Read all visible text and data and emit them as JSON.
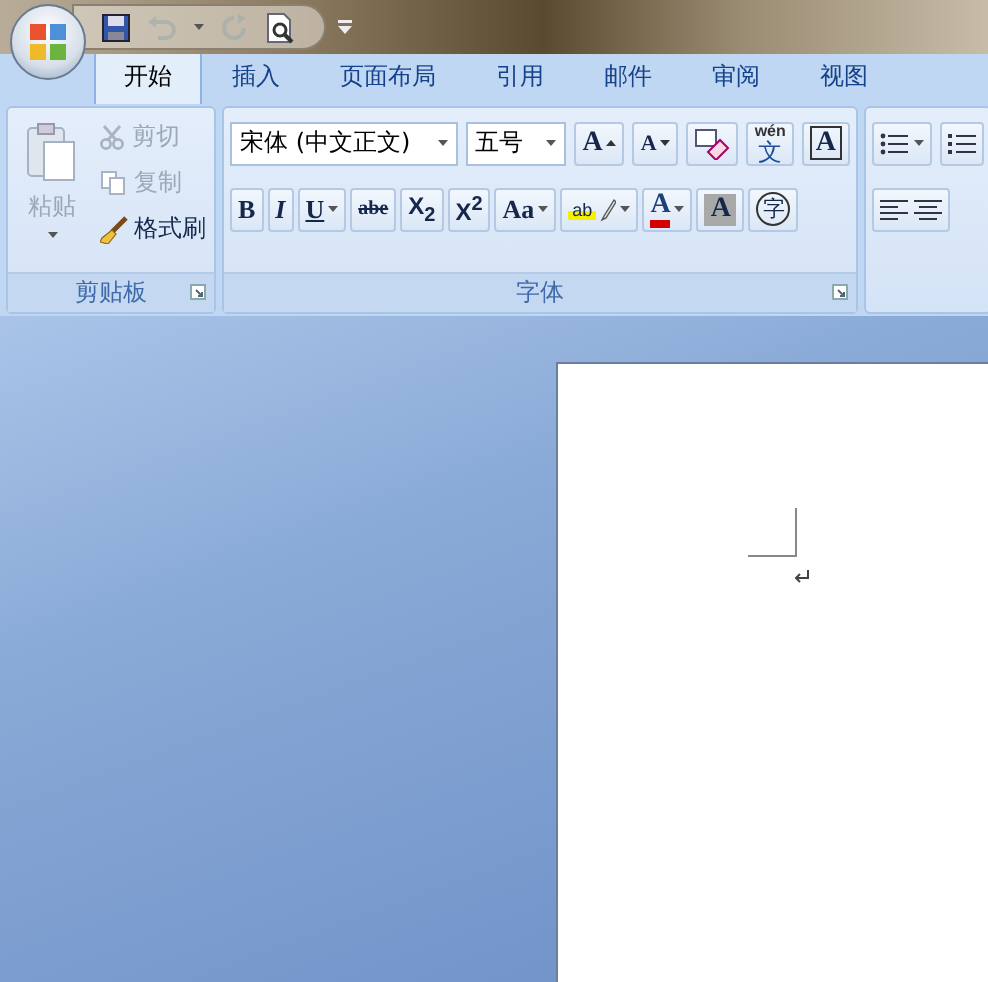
{
  "quick_access": [
    {
      "kind": "save",
      "disabled": false
    },
    {
      "kind": "undo",
      "disabled": true
    },
    {
      "kind": "redo",
      "disabled": true
    },
    {
      "kind": "print-preview",
      "disabled": false
    }
  ],
  "tabs": [
    {
      "label": "开始",
      "selected": true
    },
    {
      "label": "插入",
      "selected": false
    },
    {
      "label": "页面布局",
      "selected": false
    },
    {
      "label": "引用",
      "selected": false
    },
    {
      "label": "邮件",
      "selected": false
    },
    {
      "label": "审阅",
      "selected": false
    },
    {
      "label": "视图",
      "selected": false
    }
  ],
  "clipboard": {
    "title": "剪贴板",
    "paste": {
      "label": "粘贴",
      "disabled": true
    },
    "items": [
      {
        "kind": "cut",
        "label": "剪切",
        "disabled": true
      },
      {
        "kind": "copy",
        "label": "复制",
        "disabled": true
      },
      {
        "kind": "format-painter",
        "label": "格式刷",
        "disabled": false
      }
    ]
  },
  "font": {
    "title": "字体",
    "font_name": "宋体 (中文正文)",
    "font_size": "五号",
    "row1": [
      {
        "kind": "grow",
        "label": "A"
      },
      {
        "kind": "shrink",
        "label": "A"
      },
      {
        "kind": "clear"
      },
      {
        "kind": "pinyin",
        "label": "wén",
        "sub": "文"
      },
      {
        "kind": "border",
        "label": "A"
      }
    ],
    "row2": [
      {
        "kind": "bold",
        "label": "B"
      },
      {
        "kind": "italic",
        "label": "I"
      },
      {
        "kind": "underline",
        "label": "U"
      },
      {
        "kind": "strike",
        "label": "abe"
      },
      {
        "kind": "subscript",
        "label": "X$_{2}$"
      },
      {
        "kind": "superscript",
        "label": "X$^{2}$"
      },
      {
        "kind": "case",
        "label": "Aa"
      },
      {
        "kind": "highlight",
        "label": "ab"
      },
      {
        "kind": "color",
        "label": "A"
      },
      {
        "kind": "shading",
        "label": "A"
      },
      {
        "kind": "enclose",
        "label": "字"
      }
    ]
  }
}
